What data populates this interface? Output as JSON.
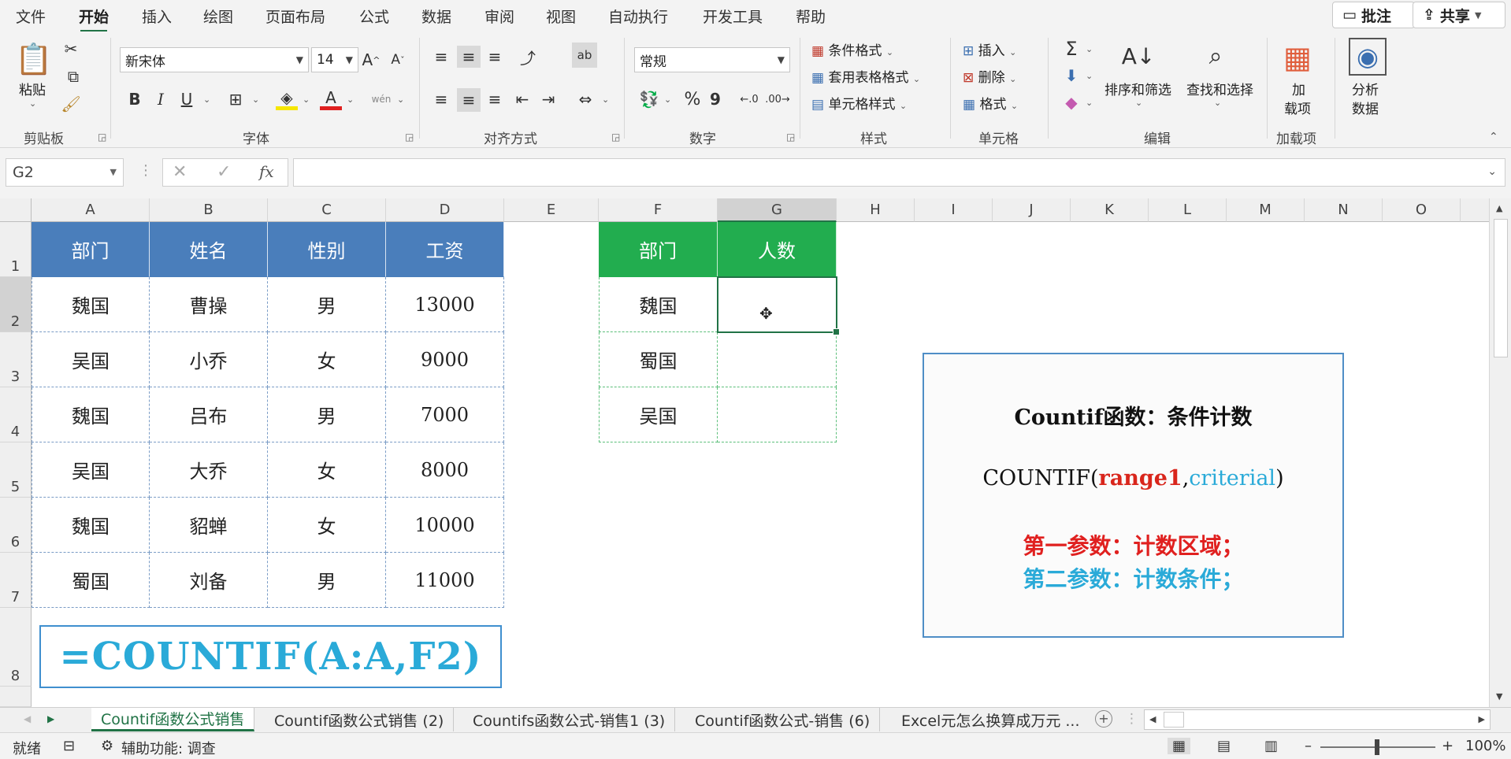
{
  "menu": {
    "items": [
      "文件",
      "开始",
      "插入",
      "绘图",
      "页面布局",
      "公式",
      "数据",
      "审阅",
      "视图",
      "自动执行",
      "开发工具",
      "帮助"
    ],
    "active": "开始",
    "comment_button": "批注",
    "share_button": "共享"
  },
  "ribbon": {
    "clipboard": {
      "paste_label": "粘贴",
      "group_label": "剪贴板"
    },
    "font": {
      "font_name": "新宋体",
      "font_size": "14",
      "group_label": "字体",
      "bold": "B",
      "italic": "I",
      "underline": "U",
      "phonetic": "wén"
    },
    "alignment": {
      "group_label": "对齐方式"
    },
    "number": {
      "format": "常规",
      "group_label": "数字",
      "percent": "%",
      "comma": "9"
    },
    "styles": {
      "conditional": "条件格式",
      "table_format": "套用表格格式",
      "cell_style": "单元格样式",
      "group_label": "样式"
    },
    "cells": {
      "insert": "插入",
      "delete": "删除",
      "format": "格式",
      "group_label": "单元格"
    },
    "editing": {
      "sort_filter": "排序和筛选",
      "find_select": "查找和选择",
      "group_label": "编辑"
    },
    "addins": {
      "label_line1": "加",
      "label_line2": "载项",
      "group_label": "加载项"
    },
    "analyze": {
      "label_line1": "分析",
      "label_line2": "数据"
    }
  },
  "formula_bar": {
    "name_box": "G2",
    "fx": "fx",
    "formula": ""
  },
  "sheet": {
    "columns": [
      "A",
      "B",
      "C",
      "D",
      "E",
      "F",
      "G",
      "H",
      "I",
      "J",
      "K",
      "L",
      "M",
      "N",
      "O"
    ],
    "rows": [
      "1",
      "2",
      "3",
      "4",
      "5",
      "6",
      "7",
      "8"
    ],
    "selected_cell": "G2",
    "table1": {
      "headers": [
        "部门",
        "姓名",
        "性别",
        "工资"
      ],
      "rows": [
        [
          "魏国",
          "曹操",
          "男",
          "13000"
        ],
        [
          "吴国",
          "小乔",
          "女",
          "9000"
        ],
        [
          "魏国",
          "吕布",
          "男",
          "7000"
        ],
        [
          "吴国",
          "大乔",
          "女",
          "8000"
        ],
        [
          "魏国",
          "貂蝉",
          "女",
          "10000"
        ],
        [
          "蜀国",
          "刘备",
          "男",
          "11000"
        ]
      ]
    },
    "table2": {
      "headers": [
        "部门",
        "人数"
      ],
      "rows": [
        [
          "魏国",
          ""
        ],
        [
          "蜀国",
          ""
        ],
        [
          "吴国",
          ""
        ]
      ]
    },
    "formula_banner": "=COUNTIF(A:A,F2)",
    "info": {
      "title": "Countif函数：条件计数",
      "syntax_prefix": "COUNTIF(",
      "syntax_arg1": "range1",
      "syntax_comma": ",",
      "syntax_arg2": "criterial",
      "syntax_suffix": ")",
      "param1": "第一参数：计数区域；",
      "param2": "第二参数：计数条件；"
    },
    "colors": {
      "header_blue": "#4a7ebb",
      "header_green": "#22ad4f",
      "red": "#e0201f",
      "cyan": "#2aaad8",
      "excel_green": "#217346"
    }
  },
  "tabs": {
    "items": [
      "Countif函数公式销售",
      "Countif函数公式销售 (2)",
      "Countifs函数公式-销售1 (3)",
      "Countif函数公式-销售 (6)",
      "Excel元怎么换算成万元 ..."
    ],
    "active_index": 0
  },
  "status": {
    "ready": "就绪",
    "accessibility": "辅助功能: 调查",
    "zoom": "100%"
  }
}
